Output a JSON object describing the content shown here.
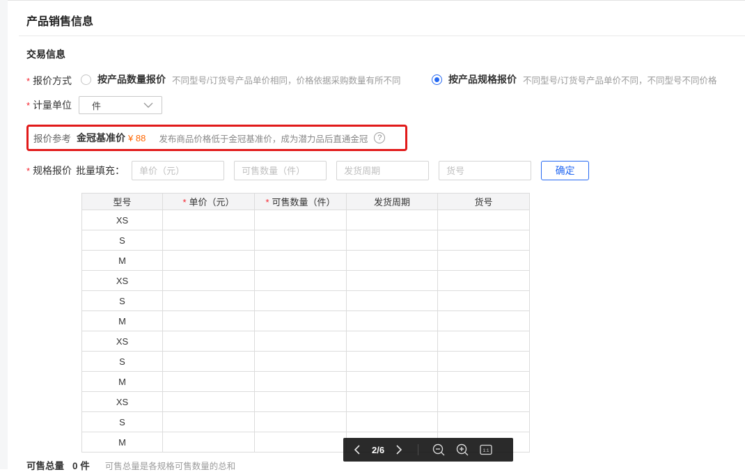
{
  "misc": {
    "required_marker": "*"
  },
  "page": {
    "title": "产品销售信息",
    "section": "交易信息"
  },
  "quote_method": {
    "label": "报价方式",
    "options": [
      {
        "label": "按产品数量报价",
        "desc": "不同型号/订货号产品单价相同，价格依据采购数量有所不同",
        "selected": false
      },
      {
        "label": "按产品规格报价",
        "desc": "不同型号/订货号产品单价不同，不同型号不同价格",
        "selected": true
      }
    ]
  },
  "unit": {
    "label": "计量单位",
    "value": "件"
  },
  "reference": {
    "label": "报价参考",
    "benchmark_label": "金冠基准价",
    "price": "¥ 88",
    "desc": "发布商品价格低于金冠基准价，成为潜力品后直通金冠",
    "help_icon": "?"
  },
  "spec_quote": {
    "label": "规格报价",
    "batch_label": "批量填充：",
    "price_placeholder": "单价（元）",
    "quantity_placeholder": "可售数量（件）",
    "cycle_placeholder": "发货周期",
    "itemno_placeholder": "货号",
    "confirm": "确定"
  },
  "table": {
    "headers": [
      {
        "label": "型号",
        "required": false
      },
      {
        "label": "单价（元）",
        "required": true
      },
      {
        "label": "可售数量（件）",
        "required": true
      },
      {
        "label": "发货周期",
        "required": false
      },
      {
        "label": "货号",
        "required": false
      }
    ],
    "rows": [
      "XS",
      "S",
      "M",
      "XS",
      "S",
      "M",
      "XS",
      "S",
      "M",
      "XS",
      "S",
      "M"
    ]
  },
  "viewer_toolbar": {
    "page_indicator": "2/6",
    "one_to_one": "1:1"
  },
  "summary": {
    "label": "可售总量",
    "value": "0 件",
    "desc": "可售总量是各规格可售数量的总和"
  },
  "colors": {
    "accent_blue": "#2468f2",
    "required_red": "#f5222d",
    "annotation_red": "#e11919",
    "price_orange": "#ff6600",
    "toolbar_bg": "#0a0a0a"
  }
}
